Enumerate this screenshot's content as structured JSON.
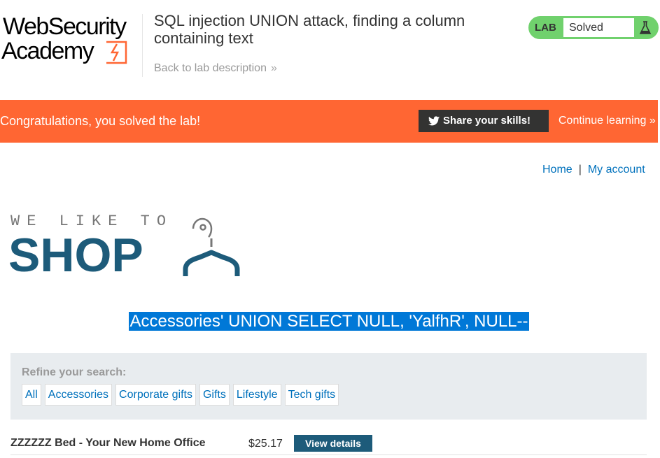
{
  "header": {
    "logo_line1": "WebSecurity",
    "logo_line2": "Academy",
    "lab_title": "SQL injection UNION attack, finding a column containing text",
    "back_link": "Back to lab description",
    "back_chevron": "»",
    "lab_tag": "LAB",
    "lab_status": "Solved",
    "status_color": "#70d16d",
    "icon": "flask-icon"
  },
  "banner": {
    "message": "Congratulations, you solved the lab!",
    "share_label": "Share your skills!",
    "share_icon": "twitter-icon",
    "continue_label": "Continue learning",
    "continue_chevron": "»",
    "color": "#ff6633"
  },
  "nav": {
    "home": "Home",
    "separator": "|",
    "account": "My account"
  },
  "shop_logo": {
    "tagline": "WE LIKE TO",
    "word": "SHOP",
    "icon": "hanger-icon"
  },
  "search": {
    "heading": "Accessories' UNION SELECT NULL, 'YalfhR', NULL--"
  },
  "filters": {
    "label": "Refine your search:",
    "items": [
      "All",
      "Accessories",
      "Corporate gifts",
      "Gifts",
      "Lifestyle",
      "Tech gifts"
    ]
  },
  "products": [
    {
      "name": "ZZZZZZ Bed - Your New Home Office",
      "price": "$25.17",
      "button": "View details"
    }
  ]
}
